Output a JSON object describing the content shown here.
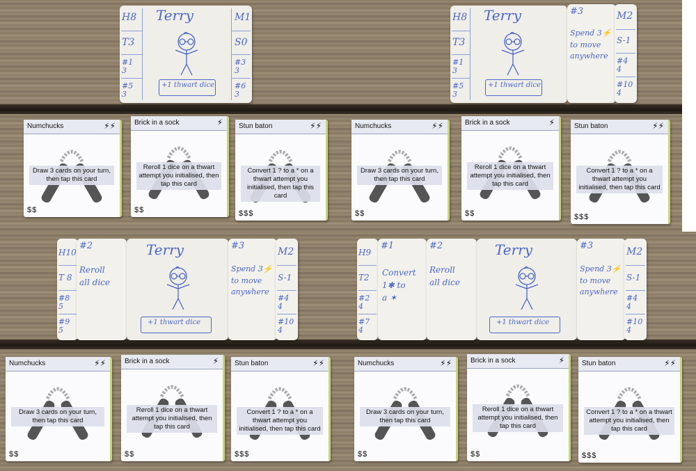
{
  "character": {
    "name": "Terry",
    "bonus": "+1 thwart dice",
    "stats_left": [
      "H8",
      "T3",
      "#1\n3",
      "#5\n3"
    ],
    "stats_right": [
      "M1",
      "S0",
      "#3\n3",
      "#6\n3"
    ],
    "stats_left_alt": [
      "H10",
      "T 8",
      "#8\n5",
      "#9\n5"
    ],
    "stats_left_alt2": [
      "H9",
      "T2",
      "#2\n4",
      "#7\n4"
    ],
    "stats_right_alt": [
      "M2",
      "S-1",
      "#4\n4",
      "#10\n4"
    ]
  },
  "addons": {
    "spend": {
      "num": "#3",
      "text": "Spend 3⚡\nto move\nanywhere"
    },
    "reroll": {
      "num": "#2",
      "text": "Reroll\nall dice"
    },
    "convert": {
      "num": "#1",
      "text": "Convert\n1✱ to\na ✶"
    }
  },
  "cards": [
    {
      "name": "Numchucks",
      "desc": "Draw 3 cards on your turn, then tap this card",
      "cost": "$$",
      "bolt": "⚡⚡"
    },
    {
      "name": "Brick in a sock",
      "desc": "Reroll 1 dice on a thwart attempt you initialised, then tap this card",
      "cost": "$$",
      "bolt": "⚡"
    },
    {
      "name": "Stun baton",
      "desc": "Convert 1 ? to a * on a thwart attempt you initialised, then tap this card",
      "cost": "$$$",
      "bolt": "⚡⚡"
    }
  ],
  "colors": {
    "ink": "#4a66c8",
    "wood": "#8f806a",
    "card_header": "#e7eaf2"
  }
}
